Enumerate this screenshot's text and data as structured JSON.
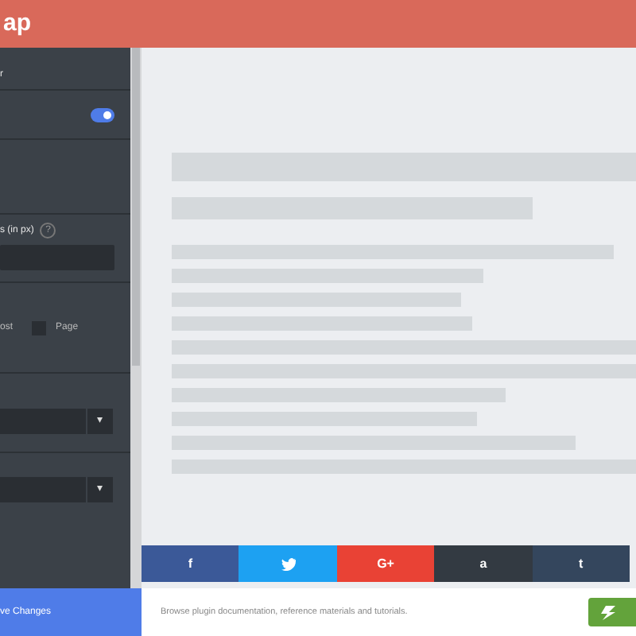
{
  "header": {
    "title": "ap"
  },
  "sidebar": {
    "subtitle": "r",
    "toggle": {
      "on": true
    },
    "field_label": "s (in px)",
    "help": "?",
    "post_label": "ost",
    "page_checkbox": {
      "label": "Page",
      "checked": false
    },
    "selects": [
      {
        "caret": "▾"
      },
      {
        "caret": "▾"
      }
    ],
    "save_button": "ve Changes"
  },
  "preview": {
    "social_buttons": [
      {
        "kind": "facebook",
        "label": "f",
        "color": "#3b5998"
      },
      {
        "kind": "twitter",
        "color": "#1da1f2"
      },
      {
        "kind": "google",
        "label": "G+",
        "color": "#e94235"
      },
      {
        "kind": "amazon",
        "label": "a",
        "color": "#333a42"
      },
      {
        "kind": "tumblr",
        "label": "t",
        "color": "#34465d"
      }
    ]
  },
  "footer": {
    "text": "Browse plugin documentation, reference materials and tutorials."
  }
}
